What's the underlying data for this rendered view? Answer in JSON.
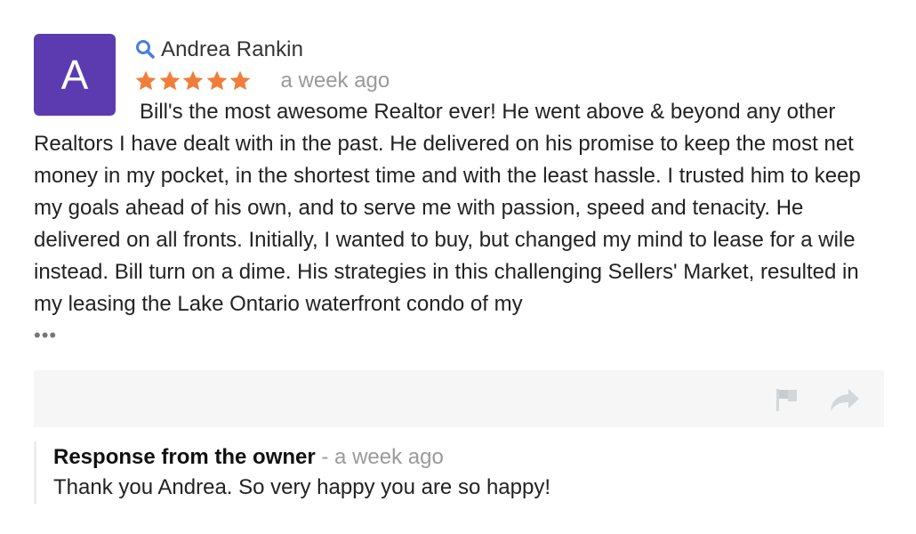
{
  "review": {
    "avatar_letter": "A",
    "avatar_color": "#5c3bb1",
    "author": "Andrea Rankin",
    "rating": 5,
    "rating_max": 5,
    "star_color": "#f07e3a",
    "time": "a week ago",
    "text": "Bill's the most awesome Realtor ever! He went above & beyond any other Realtors I have dealt with in the past. He delivered on his promise to keep the most net money in my pocket, in the shortest time and with the least hassle. I trusted him to keep my goals ahead of his own, and to serve me with passion, speed and tenacity. He delivered on all fronts. Initially, I wanted to buy, but changed my mind to lease for a wile instead. Bill turn on a dime. His strategies in this challenging Sellers' Market, resulted in my leasing the Lake Ontario waterfront condo of my",
    "more": "•••"
  },
  "icons": {
    "author": "search-icon",
    "flag": "flag-icon",
    "share": "share-icon",
    "more": "more-dots-icon"
  },
  "owner_response": {
    "title": "Response from the owner",
    "separator": " - ",
    "time": "a week ago",
    "text": "Thank you Andrea. So very happy you are so happy!"
  },
  "colors": {
    "search_icon": "#4a7de3",
    "action_icon": "#d3d7da",
    "action_bar_bg": "#f6f6f6"
  }
}
